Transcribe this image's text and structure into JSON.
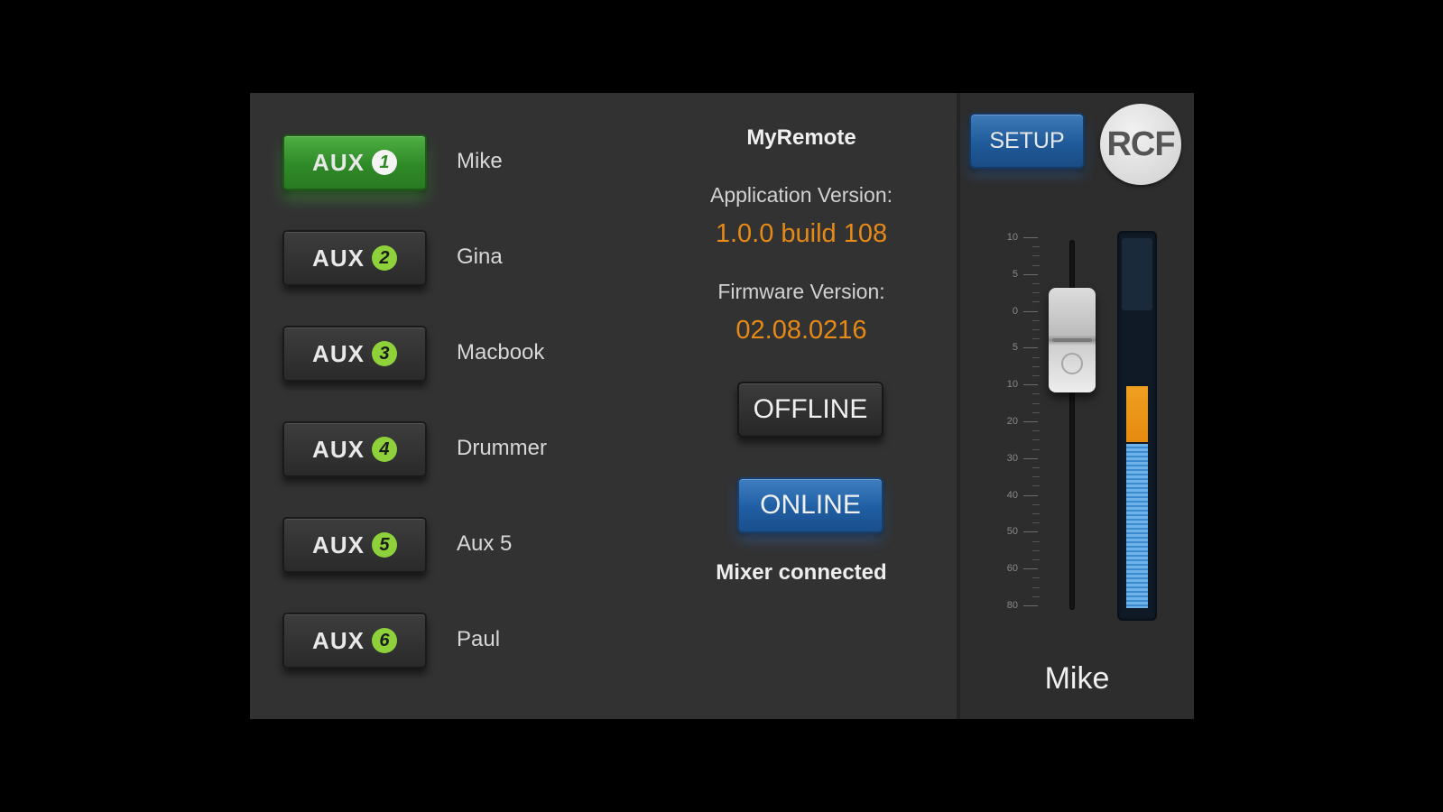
{
  "aux_channels": [
    {
      "label": "AUX",
      "number": "1",
      "name": "Mike",
      "active": true
    },
    {
      "label": "AUX",
      "number": "2",
      "name": "Gina",
      "active": false
    },
    {
      "label": "AUX",
      "number": "3",
      "name": "Macbook",
      "active": false
    },
    {
      "label": "AUX",
      "number": "4",
      "name": "Drummer",
      "active": false
    },
    {
      "label": "AUX",
      "number": "5",
      "name": "Aux 5",
      "active": false
    },
    {
      "label": "AUX",
      "number": "6",
      "name": "Paul",
      "active": false
    }
  ],
  "info": {
    "app_name": "MyRemote",
    "app_version_label": "Application Version:",
    "app_version": "1.0.0 build 108",
    "firmware_label": "Firmware Version:",
    "firmware_version": "02.08.0216",
    "offline_label": "OFFLINE",
    "online_label": "ONLINE",
    "status": "Mixer connected"
  },
  "right_panel": {
    "setup_label": "SETUP",
    "logo_text": "RCF",
    "scale": [
      "10",
      "5",
      "0",
      "5",
      "10",
      "20",
      "30",
      "40",
      "50",
      "60",
      "80"
    ],
    "fader_level": 0.82,
    "meter_blue_level": 0.45,
    "meter_orange_level": 0.16,
    "channel_name": "Mike"
  },
  "colors": {
    "active_green": "#2f8a27",
    "accent_blue": "#1f5ea3",
    "version_orange": "#e58a17"
  }
}
